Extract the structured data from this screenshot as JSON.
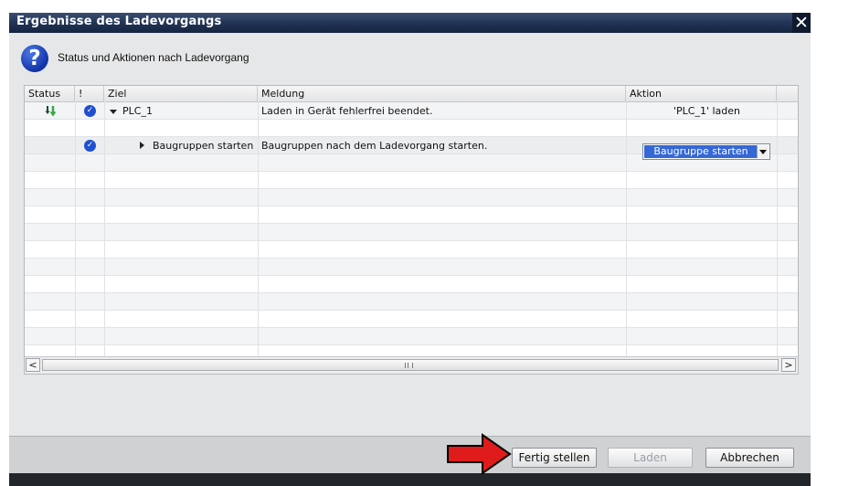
{
  "dialog": {
    "title": "Ergebnisse des Ladevorgangs",
    "close_glyph": "✕",
    "subtitle": "Status und Aktionen nach Ladevorgang",
    "question_glyph": "?"
  },
  "table": {
    "columns": {
      "status": "Status",
      "flag": "!",
      "target": "Ziel",
      "message": "Meldung",
      "action": "Aktion"
    },
    "rows": [
      {
        "status_icon": "download-arrows-icon",
        "check_icon": "checkmark-circle-icon",
        "target": "PLC_1",
        "message": "Laden in Gerät fehlerfrei beendet.",
        "action": "'PLC_1' laden"
      },
      {
        "check_icon": "checkmark-circle-icon",
        "target": "Baugruppen starten",
        "message": "Baugruppen nach dem Ladevorgang starten.",
        "action": "Baugruppe starten"
      }
    ]
  },
  "scrollbar": {
    "left_glyph": "<",
    "right_glyph": ">"
  },
  "buttons": {
    "finish": "Fertig stellen",
    "load": "Laden",
    "cancel": "Abbrechen"
  },
  "annotation": {
    "arrow_color": "#e01b1b",
    "points_to": "finish-button"
  },
  "colors": {
    "title_bar": "#1f3052",
    "selection": "#3567d6",
    "check": "#1f4fd0"
  }
}
